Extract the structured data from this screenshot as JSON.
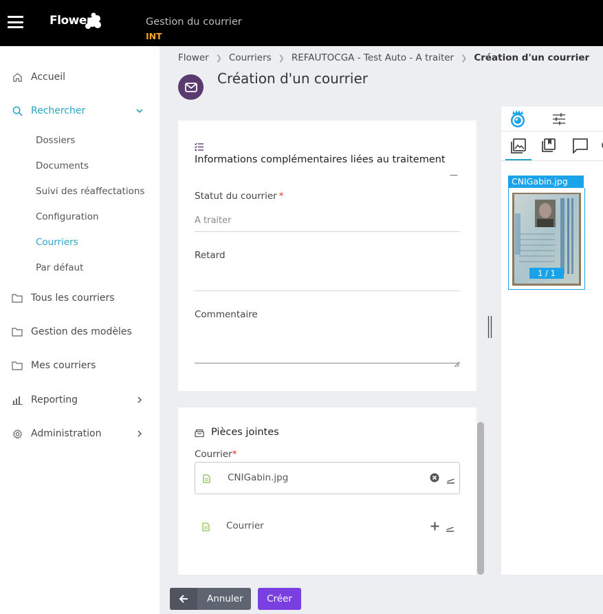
{
  "header": {
    "logo_text": "Flower",
    "app_title": "Gestion du courrier",
    "environment": "INT"
  },
  "sidebar": {
    "items": [
      {
        "label": "Accueil",
        "icon": "home-icon"
      },
      {
        "label": "Rechercher",
        "icon": "search-icon",
        "expanded": true
      },
      {
        "label": "Tous les courriers",
        "icon": "folder-icon"
      },
      {
        "label": "Gestion des modèles",
        "icon": "folder-icon"
      },
      {
        "label": "Mes courriers",
        "icon": "folder-icon"
      },
      {
        "label": "Reporting",
        "icon": "bar-chart-icon"
      },
      {
        "label": "Administration",
        "icon": "gear-icon"
      }
    ],
    "sub_items": [
      {
        "label": "Dossiers"
      },
      {
        "label": "Documents"
      },
      {
        "label": "Suivi des réaffectations"
      },
      {
        "label": "Configuration"
      },
      {
        "label": "Courriers",
        "active": true
      },
      {
        "label": "Par défaut"
      }
    ]
  },
  "breadcrumb": {
    "items": [
      "Flower",
      "Courriers",
      "REFAUTOCGA - Test Auto - A traiter",
      "Création d'un courrier"
    ]
  },
  "page": {
    "title": "Création d'un courrier"
  },
  "info_section": {
    "title": "Informations complémentaires liées au traitement",
    "collapse_symbol": "—",
    "status_label": "Statut du courrier",
    "required_mark": "*",
    "status_value": "A traiter",
    "delay_label": "Retard",
    "delay_value": "",
    "comment_label": "Commentaire",
    "comment_value": ""
  },
  "attachments": {
    "title": "Pièces jointes",
    "courrier_label": "Courrier",
    "required_mark": "*",
    "file_name": "CNIGabin.jpg",
    "empty_slot_label": "Courrier"
  },
  "viewer": {
    "file_title": "CNIGabin.jpg",
    "page_indicator": "1 / 1"
  },
  "footer": {
    "back_label": "Annuler",
    "create_label": "Créer"
  },
  "colors": {
    "accent": "#29a3c4",
    "primary_button": "#7a3fe0",
    "env": "#f5a623",
    "required": "#e0302a",
    "viewer_blue": "#1aa3e8"
  }
}
